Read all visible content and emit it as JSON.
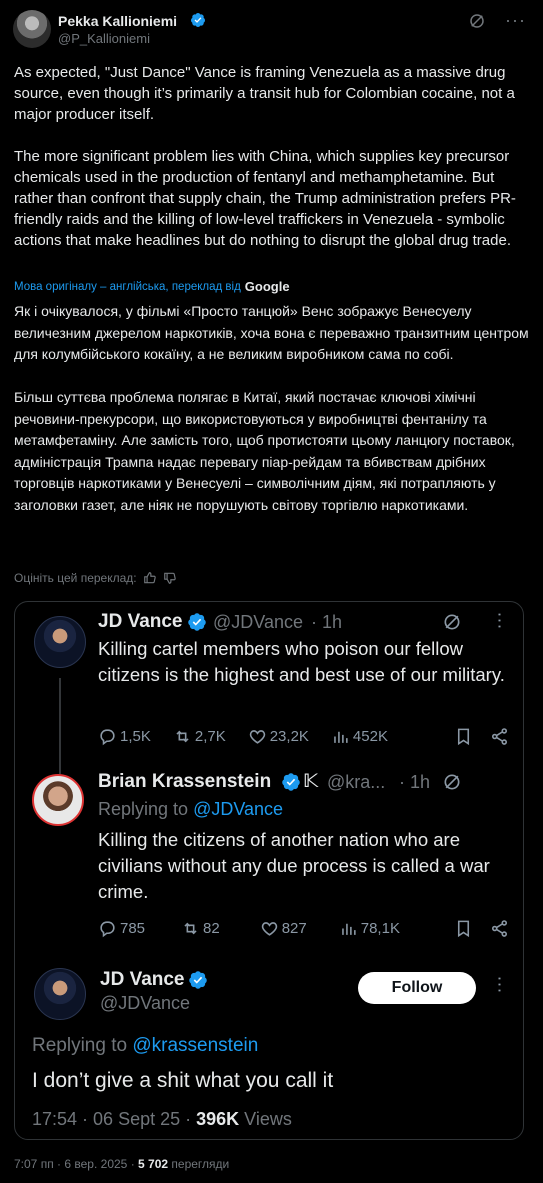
{
  "author": {
    "name": "Pekka Kallioniemi",
    "handle": "@P_Kallioniemi"
  },
  "tweet": {
    "text": "As expected, \"Just Dance\" Vance is framing Venezuela as a massive drug source, even though it’s primarily a transit hub for Colombian cocaine, not a major producer itself.\n\nThe more significant problem lies with China, which supplies key precursor chemicals used in the production of fentanyl and methamphetamine. But rather than confront that supply chain, the Trump administration prefers PR-friendly raids and the killing of low-level traffickers in Venezuela - symbolic actions that make headlines but do nothing to disrupt the global drug trade.",
    "translated_by_label": "Мова оригіналу – англійська, переклад від",
    "translator": "Google",
    "translation": "Як і очікувалося, у фільмі «Просто танцюй» Венс зображує Венесуелу величезним джерелом наркотиків, хоча вона є переважно транзитним центром для колумбійського кокаїну, а не великим виробником сама по собі.\n\nБільш суттєва проблема полягає в Китаї, який постачає ключові хімічні речовини-прекурсори, що використовуються у виробництві фентанілу та метамфетаміну. Але замість того, щоб протистояти цьому ланцюгу поставок, адміністрація Трампа надає перевагу піар-рейдам та вбивствам дрібних торговців наркотиками у Венесуелі – символічним діям, які потрапляють у заголовки газет, але ніяк не порушують світову торгівлю наркотиками.",
    "rate_label": "Оцініть цей переклад:",
    "time": "7:07 пп",
    "dot": "·",
    "date": "6 вер. 2025",
    "views_count": "5 702",
    "views_label": "перегляди"
  },
  "quote": {
    "post1": {
      "name": "JD Vance",
      "handle": "@JDVance",
      "age": "· 1h",
      "text": "Killing cartel members who poison our fellow citizens is the highest and best use of our military.",
      "replies": "1,5K",
      "reposts": "2,7K",
      "likes": "23,2K",
      "views": "452K"
    },
    "post2": {
      "name": "Brian Krassenstein",
      "handle": "@kra...",
      "age": "· 1h",
      "replying_to_label": "Replying to",
      "replying_to": "@JDVance",
      "text": "Killing the citizens of another nation who are civilians without any due process is called a war crime.",
      "replies": "785",
      "reposts": "82",
      "likes": "827",
      "views": "78,1K"
    },
    "post3": {
      "name": "JD Vance",
      "handle": "@JDVance",
      "follow_label": "Follow",
      "replying_to_label": "Replying to",
      "replying_to": "@krassenstein",
      "text": "I don’t give a shit what you call it",
      "time": "17:54 · 06 Sept 25 ·",
      "views_count": "396K",
      "views_label": "Views"
    }
  },
  "colors": {
    "accent": "#1d9bf0",
    "background": "#000000",
    "text": "#e7e9ea",
    "muted": "#71767b"
  },
  "icons": [
    "verified-icon",
    "grok-icon",
    "more-icon",
    "thumbs-up-icon",
    "thumbs-down-icon",
    "reply-icon",
    "repost-icon",
    "like-icon",
    "views-icon",
    "bookmark-icon",
    "share-icon"
  ]
}
